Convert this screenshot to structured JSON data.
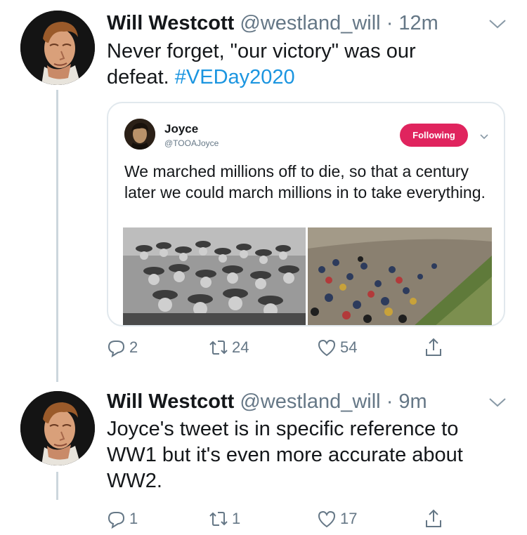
{
  "tweets": [
    {
      "name": "Will Westcott",
      "handle": "@westland_will",
      "sep": "·",
      "time": "12m",
      "text": "Never forget, \"our victory\" was our defeat. ",
      "hashtag": "#VEDay2020",
      "quoted": {
        "name": "Joyce",
        "handle": "@TOOAJoyce",
        "follow_label": "Following",
        "text": "We marched millions off to die, so that a century later we could march millions in to take everything."
      },
      "replies": "2",
      "retweets": "24",
      "likes": "54"
    },
    {
      "name": "Will Westcott",
      "handle": "@westland_will",
      "sep": "·",
      "time": "9m",
      "text": "Joyce's tweet is in specific reference to WW1 but it's even more accurate about WW2.",
      "replies": "1",
      "retweets": "1",
      "likes": "17"
    }
  ],
  "icons": {
    "reply": "reply-icon",
    "retweet": "retweet-icon",
    "like": "heart-icon",
    "share": "share-icon",
    "menu": "chevron-down-icon"
  },
  "colors": {
    "link": "#1b95e0",
    "following_button": "#e0245e",
    "secondary_text": "#657786",
    "thread_line": "#ccd6dd"
  }
}
